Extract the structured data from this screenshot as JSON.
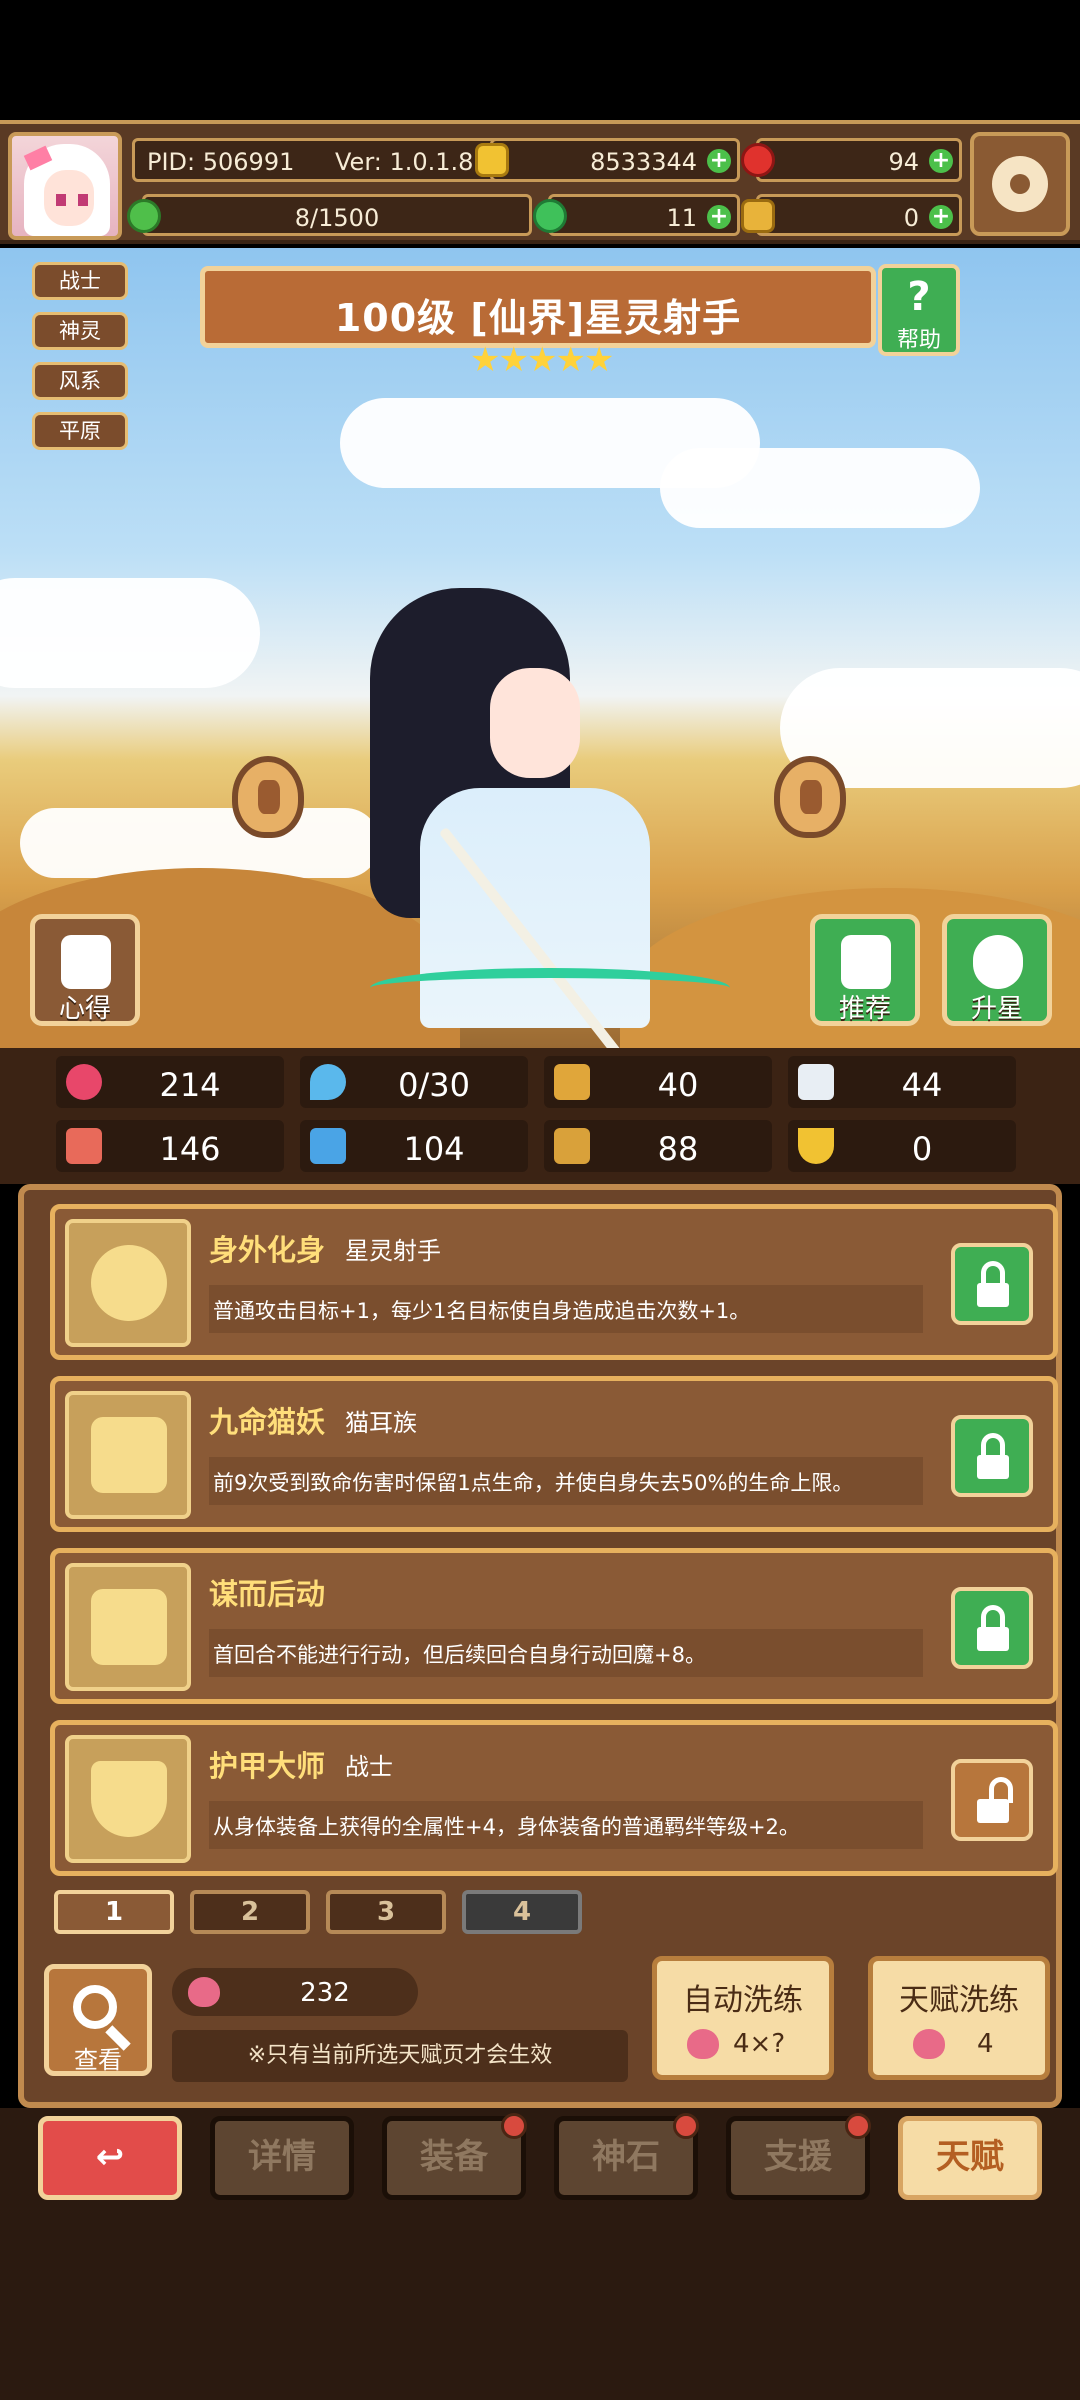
{
  "header": {
    "pid": "PID: 506991",
    "ver": "Ver: 1.0.1.8",
    "gold": "8533344",
    "gems": "94",
    "energy": "8/1500",
    "clover": "11",
    "bag": "0"
  },
  "tags": [
    "战士",
    "神灵",
    "风系",
    "平原"
  ],
  "title": "100级  [仙界]星灵射手",
  "stars": "★★★★★",
  "help_label": "帮助",
  "help_glyph": "?",
  "actions": {
    "xinde": "心得",
    "recommend": "推荐",
    "upstar": "升星"
  },
  "stats": [
    "214",
    "0/30",
    "40",
    "44",
    "146",
    "104",
    "88",
    "0"
  ],
  "talents": [
    {
      "name": "身外化身",
      "sub": "星灵射手",
      "desc": "普通攻击目标+1，每少1名目标使自身造成追击次数+1。"
    },
    {
      "name": "九命猫妖",
      "sub": "猫耳族",
      "desc": "前9次受到致命伤害时保留1点生命，并使自身失去50%的生命上限。"
    },
    {
      "name": "谋而后动",
      "sub": "",
      "desc": "首回合不能进行行动，但后续回合自身行动回魔+8。"
    },
    {
      "name": "护甲大师",
      "sub": "战士",
      "desc": "从身体装备上获得的全属性+4，身体装备的普通羁绊等级+2。"
    }
  ],
  "pages": [
    "1",
    "2",
    "3",
    "4"
  ],
  "search_label": "查看",
  "peach_count": "232",
  "note": "※只有当前所选天赋页才会生效",
  "auto_refine": {
    "label": "自动洗练",
    "cost": "4×?"
  },
  "talent_refine": {
    "label": "天赋洗练",
    "cost": "4"
  },
  "nav": {
    "back": "↩",
    "details": "详情",
    "equip": "装备",
    "stone": "神石",
    "support": "支援",
    "talent": "天赋"
  },
  "colors": {
    "lock_green": "#3fae53",
    "lock_brown": "#b7763c",
    "accent_gold": "#e7b15e",
    "back_red": "#e24c4a"
  }
}
